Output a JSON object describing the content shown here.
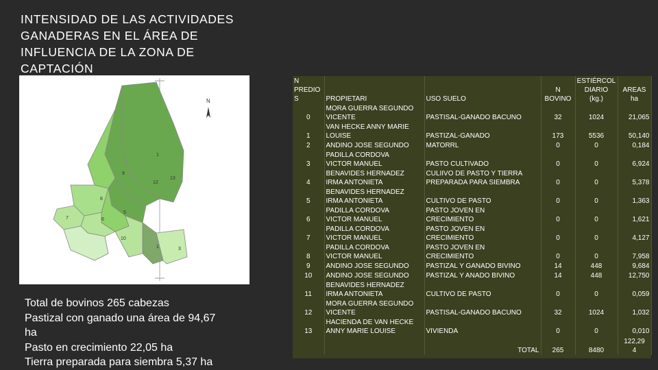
{
  "title_lines": [
    "INTENSIDAD DE LAS ACTIVIDADES",
    "GANADERAS EN EL ÁREA DE",
    "INFLUENCIA DE LA ZONA DE",
    "CAPTACIÓN"
  ],
  "map": {
    "north_label": "N",
    "parcel_labels": [
      "1",
      "9",
      "12",
      "13",
      "8",
      "5",
      "6",
      "7",
      "10",
      "3",
      "1"
    ],
    "colors": {
      "dark": "#6aa84f",
      "mid": "#8fd16a",
      "light": "#b6e49a",
      "pale": "#d3efc4",
      "olive": "#7fa86a",
      "outline": "#888888"
    }
  },
  "summary": [
    "Total de bovinos 265 cabezas",
    "Pastizal con ganado una área de 94,67",
    "ha",
    "Pasto en crecimiento 22,05 ha",
    "Tierra preparada para siembra  5,37 ha"
  ],
  "table": {
    "headers": {
      "predios": [
        "N",
        "PREDIO",
        "S"
      ],
      "propietario": "PROPIETARI",
      "uso": "USO SUELO",
      "bovino": [
        "N",
        "BOVINO"
      ],
      "estiercol": [
        "ESTIÉRCOL",
        "DIARIO (kg.)"
      ],
      "areas": [
        "AREAS",
        "ha"
      ]
    },
    "rows": [
      {
        "n": "0",
        "prop": [
          "MORA GUERRA SEGUNDO",
          "VICENTE"
        ],
        "uso": [
          "PASTISAL-GANADO BACUNO"
        ],
        "bov": "32",
        "est": "1024",
        "area": "21,065",
        "tall": true
      },
      {
        "n": "1",
        "prop": [
          "VAN HECKE ANNY MARIE",
          "LOUISE"
        ],
        "uso": [
          "PASTIZAL-GANADO"
        ],
        "bov": "173",
        "est": "5536",
        "area": "50,140",
        "tall": true
      },
      {
        "n": "2",
        "prop": [
          "ANDINO JOSE SEGUNDO"
        ],
        "uso": [
          "MATORRL"
        ],
        "bov": "0",
        "est": "0",
        "area": "0,184",
        "tall": false
      },
      {
        "n": "3",
        "prop": [
          "PADILLA CORDOVA",
          "VICTOR MANUEL"
        ],
        "uso": [
          "PASTO CULTIVADO"
        ],
        "bov": "0",
        "est": "0",
        "area": "6,924",
        "tall": true
      },
      {
        "n": "4",
        "prop": [
          "BENAVIDES HERNADEZ",
          "IRMA ANTONIETA"
        ],
        "uso": [
          "CULIIVO DE PASTO Y TIERRA",
          "PREPARADA PARA SIEMBRA"
        ],
        "bov": "0",
        "est": "0",
        "area": "5,378",
        "tall": true
      },
      {
        "n": "5",
        "prop": [
          "BENAVIDES HERNADEZ",
          "IRMA ANTONIETA"
        ],
        "uso": [
          "CULTIVO DE PASTO"
        ],
        "bov": "0",
        "est": "0",
        "area": "1,363",
        "tall": true
      },
      {
        "n": "6",
        "prop": [
          "PADILLA CORDOVA",
          "VICTOR MANUEL"
        ],
        "uso": [
          "PASTO JOVEN EN",
          "CRECIMIENTO"
        ],
        "bov": "0",
        "est": "0",
        "area": "1,621",
        "tall": true
      },
      {
        "n": "7",
        "prop": [
          "PADILLA CORDOVA",
          "VICTOR MANUEL"
        ],
        "uso": [
          "PASTO JOVEN EN",
          "CRECIMIENTO"
        ],
        "bov": "0",
        "est": "0",
        "area": "4,127",
        "tall": true
      },
      {
        "n": "8",
        "prop": [
          "PADILLA CORDOVA",
          "VICTOR MANUEL"
        ],
        "uso": [
          "PASTO JOVEN EN",
          "CRECIMIENTO"
        ],
        "bov": "0",
        "est": "0",
        "area": "7,958",
        "tall": true
      },
      {
        "n": "9",
        "prop": [
          "ANDINO JOSE SEGUNDO"
        ],
        "uso": [
          "PASTIZAL Y GANADO BIVINO"
        ],
        "bov": "14",
        "est": "448",
        "area": "9,684",
        "tall": false
      },
      {
        "n": "10",
        "prop": [
          "ANDINO JOSE SEGUNDO"
        ],
        "uso": [
          "PASTIZAL Y ANADO BIVINO"
        ],
        "bov": "14",
        "est": "448",
        "area": "12,750",
        "tall": false
      },
      {
        "n": "11",
        "prop": [
          "BENAVIDES HERNADEZ",
          "IRMA ANTONIETA"
        ],
        "uso": [
          "CULTIVO DE PASTO"
        ],
        "bov": "0",
        "est": "0",
        "area": "0,059",
        "tall": true
      },
      {
        "n": "12",
        "prop": [
          "MORA GUERRA SEGUNDO",
          "VICENTE"
        ],
        "uso": [
          "PASTISAL-GANADO BACUNO"
        ],
        "bov": "32",
        "est": "1024",
        "area": "1,032",
        "tall": true
      },
      {
        "n": "13",
        "prop": [
          "HACIENDA DE VAN HECKE",
          "ANNY MARIE LOUISE"
        ],
        "uso": [
          "VIVIENDA"
        ],
        "bov": "0",
        "est": "0",
        "area": "0,010",
        "tall": true
      }
    ],
    "total": {
      "label": "TOTAL",
      "bov": "265",
      "est": "8480",
      "area": [
        "122,29",
        "4"
      ]
    }
  }
}
